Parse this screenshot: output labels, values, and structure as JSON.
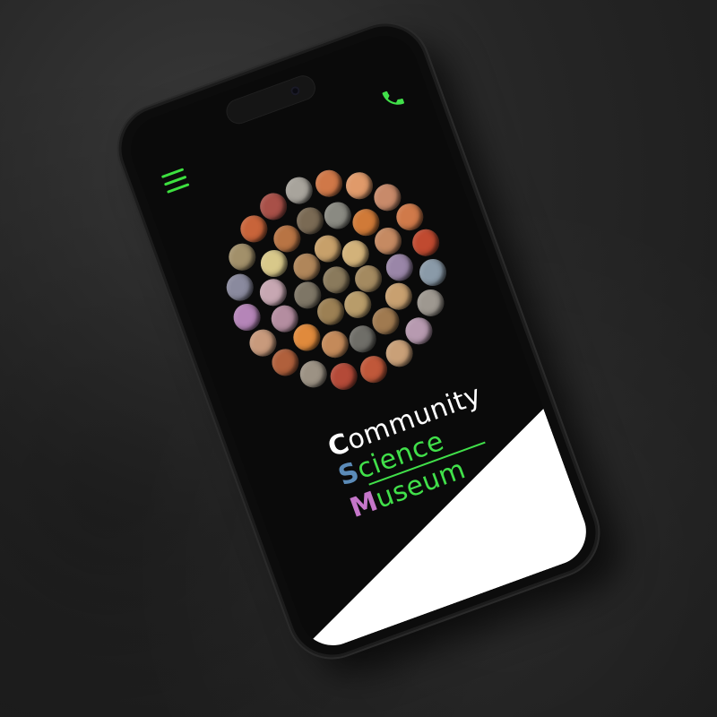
{
  "logo": {
    "line1_first": "C",
    "line1_rest": "ommunity",
    "line2_first": "S",
    "line2_rest": "cience",
    "line3_first": "M",
    "line3_rest": "useum"
  },
  "header": {
    "menu_icon": "hamburger-menu-icon",
    "call_icon": "phone-icon"
  },
  "colors": {
    "accent_green": "#41e04a",
    "science_blue": "#5b8bb8",
    "museum_pink": "#c576c9",
    "screen_bg": "#0a0a0a"
  },
  "hero": {
    "image": "collage of moon photographs in many colors arranged in a circle",
    "moons": [
      "#8a7a5c",
      "#a48a60",
      "#b89c6a",
      "#9c8054",
      "#7e7666",
      "#b0865a",
      "#c7a06a",
      "#d2b27a",
      "#c8a070",
      "#a07a50",
      "#6f6e68",
      "#c48a5a",
      "#e08a3c",
      "#b48da0",
      "#c7a7b2",
      "#d8c88a",
      "#b87444",
      "#7a6a54",
      "#8a8a82",
      "#d07a38",
      "#c58a62",
      "#9a86a8",
      "#b79ab0",
      "#c9a078",
      "#c0583a",
      "#b44a38",
      "#9c9284",
      "#b0603c",
      "#c89a7c",
      "#b585b8",
      "#8a8a9e",
      "#a2906a",
      "#c8643a",
      "#a85048",
      "#a8a49c",
      "#d07848",
      "#e09a6a",
      "#c88a6a",
      "#d07a4a",
      "#c04a30",
      "#8a9aa8",
      "#9e9890",
      "#b8aca8",
      "#d46a38",
      "#c86a3c",
      "#d05a2c",
      "#7a8a9c",
      "#8c8c88",
      "#b6b2aa",
      "#a09c94",
      "#b8b4ac"
    ]
  }
}
